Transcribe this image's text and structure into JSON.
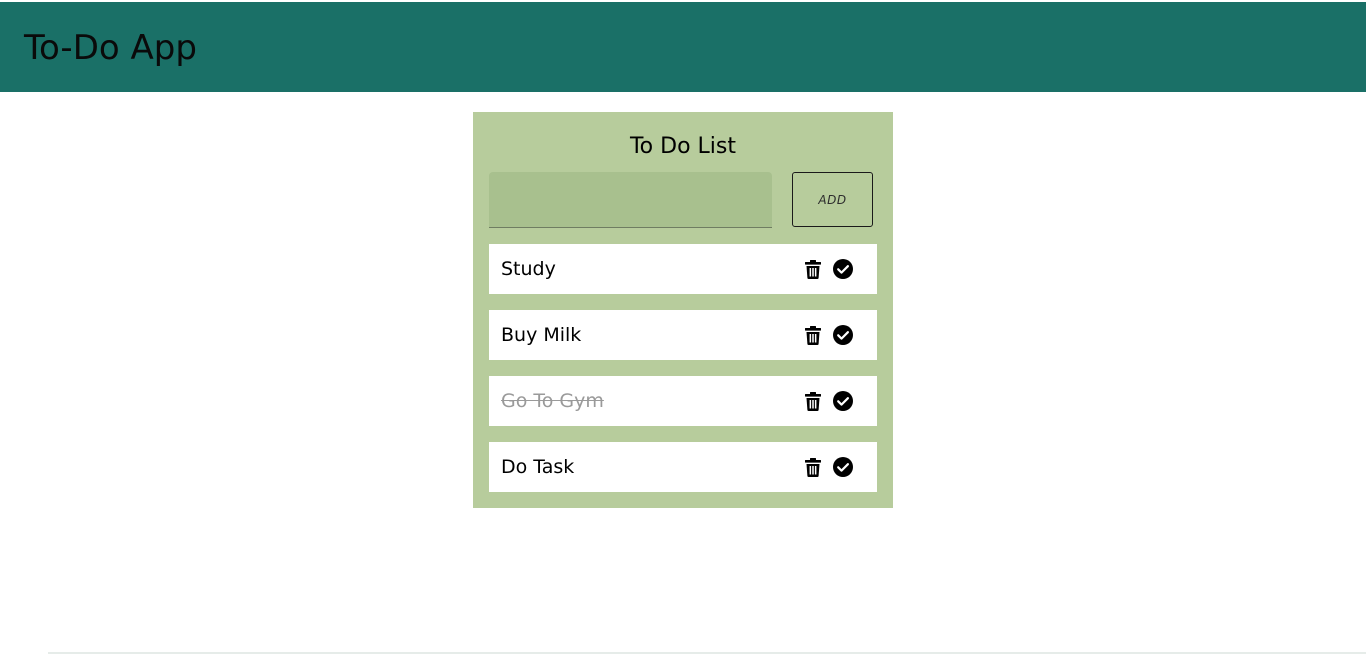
{
  "header": {
    "title": "To-Do App",
    "background": "#1a7067"
  },
  "card": {
    "title": "To Do List",
    "background": "#b7cc9c",
    "input": {
      "value": "",
      "placeholder": ""
    },
    "add_label": "ADD"
  },
  "tasks": [
    {
      "text": "Study",
      "completed": false,
      "delete_icon": "trash-icon",
      "complete_icon": "check-circle-icon"
    },
    {
      "text": "Buy Milk",
      "completed": false,
      "delete_icon": "trash-icon",
      "complete_icon": "check-circle-icon"
    },
    {
      "text": "Go To Gym",
      "completed": true,
      "delete_icon": "trash-icon",
      "complete_icon": "check-circle-icon"
    },
    {
      "text": "Do Task",
      "completed": false,
      "delete_icon": "trash-icon",
      "complete_icon": "check-circle-icon"
    }
  ]
}
